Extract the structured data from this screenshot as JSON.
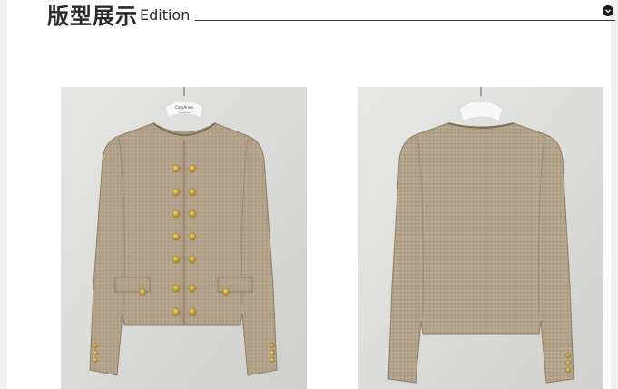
{
  "header": {
    "title_cn": "版型展示",
    "title_en": "Edition",
    "toggle_icon": "chevron-down-icon"
  },
  "gallery": {
    "front": {
      "hanger_label_line1": "CatyAnna",
      "hanger_label_line2": "Studios"
    },
    "back": {}
  },
  "colors": {
    "background": "#f0f0f0",
    "panel": "#ffffff",
    "jacket": "#b2a18a",
    "buttons": "#c9a13d"
  }
}
